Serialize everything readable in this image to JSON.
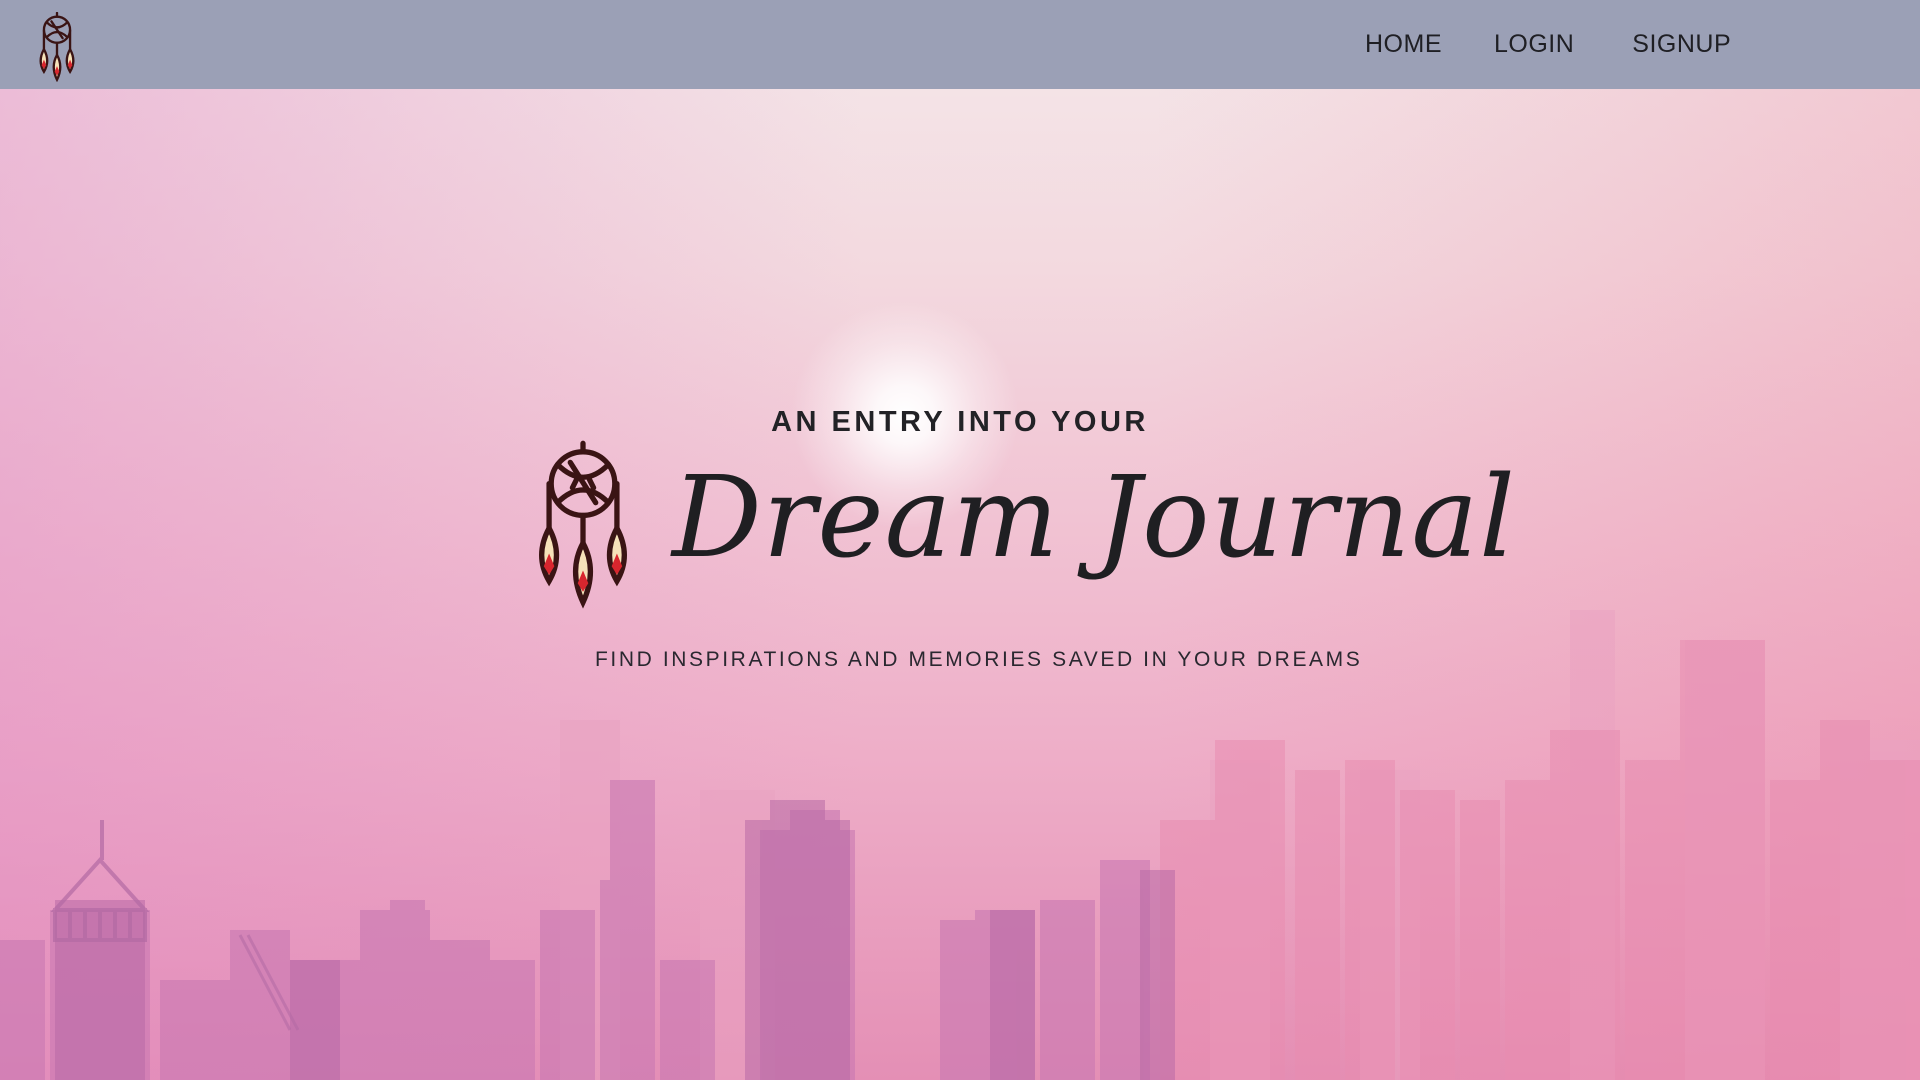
{
  "nav": {
    "logo_icon": "dreamcatcher-icon",
    "links": [
      "HOME",
      "LOGIN",
      "SIGNUP"
    ]
  },
  "hero": {
    "eyebrow": "AN ENTRY INTO YOUR",
    "logo_icon": "dreamcatcher-icon",
    "title": "Dream Journal",
    "subtitle": "FIND INSPIRATIONS AND MEMORIES SAVED IN YOUR DREAMS"
  },
  "colors": {
    "nav_background": "#9ba0b6",
    "text_dark": "#222226",
    "sky_top": "#f4e8ea",
    "sky_bottom": "#e48fb5",
    "feather_fill": "#f6e2b9",
    "feather_accent": "#d8262e",
    "icon_stroke": "#3a1414"
  }
}
